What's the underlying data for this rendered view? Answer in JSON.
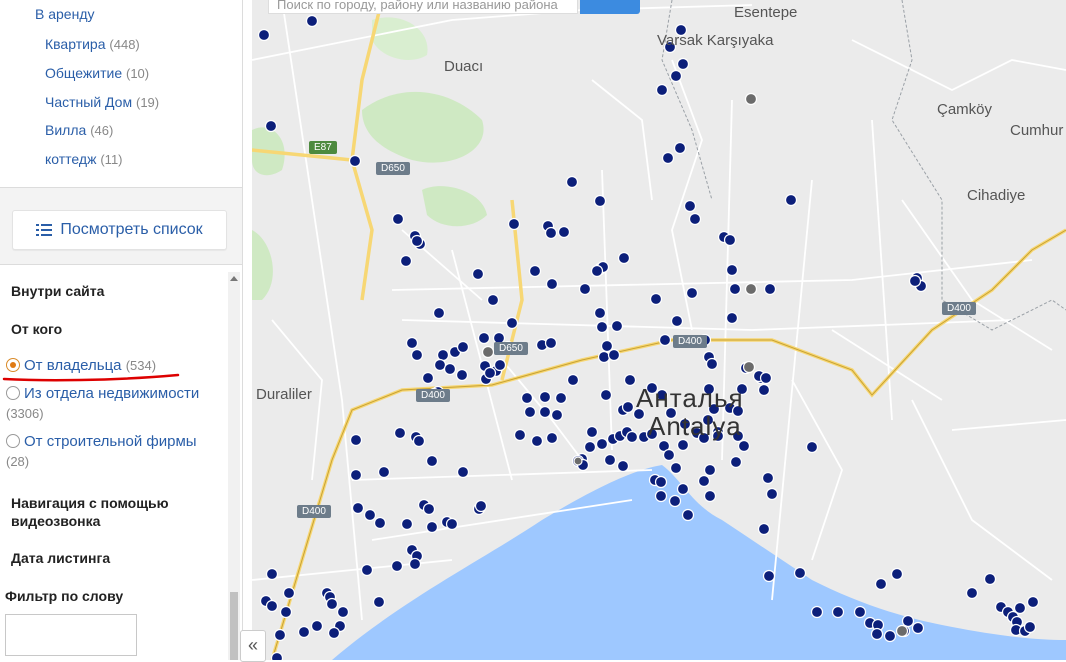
{
  "categories": {
    "parent": "В аренду",
    "items": [
      {
        "label": "Квартира",
        "count": "(448)"
      },
      {
        "label": "Общежитие",
        "count": "(10)"
      },
      {
        "label": "Частный Дом",
        "count": "(19)"
      },
      {
        "label": "Вилла",
        "count": "(46)"
      },
      {
        "label": "коттедж",
        "count": "(11)"
      }
    ]
  },
  "view_list_button": "Посмотреть список",
  "filters": {
    "inside_site": "Внутри сайта",
    "from_whom": "От кого",
    "options": [
      {
        "label": "От владельца",
        "count": "(534)",
        "checked": true
      },
      {
        "label": "Из отдела недвижимости",
        "count": "(3306)",
        "checked": false
      },
      {
        "label": "От строительной фирмы",
        "count": "(28)",
        "checked": false
      }
    ],
    "video_nav": "Навигация с помощью видеозвонка",
    "listing_date": "Дата листинга",
    "word_filter": "Фильтр по слову"
  },
  "map": {
    "search_placeholder": "Поиск по городу, району или названию района",
    "places": [
      "Duacı",
      "Varsak Karşıyaka",
      "Esentepe",
      "Çamköy",
      "Cumhur",
      "Cihadiye",
      "Duraliler"
    ],
    "city": [
      "Анталья",
      "Antalya"
    ],
    "road_shields": [
      "E87",
      "D650",
      "D650",
      "D400",
      "D400",
      "D400",
      "D400"
    ],
    "marker_color": "#0c1f7a",
    "marker_color_secondary": "#6b6b6b",
    "sea_color": "#9ec8ff",
    "green_color": "#cfe9c3"
  },
  "collapse_icon": "«"
}
